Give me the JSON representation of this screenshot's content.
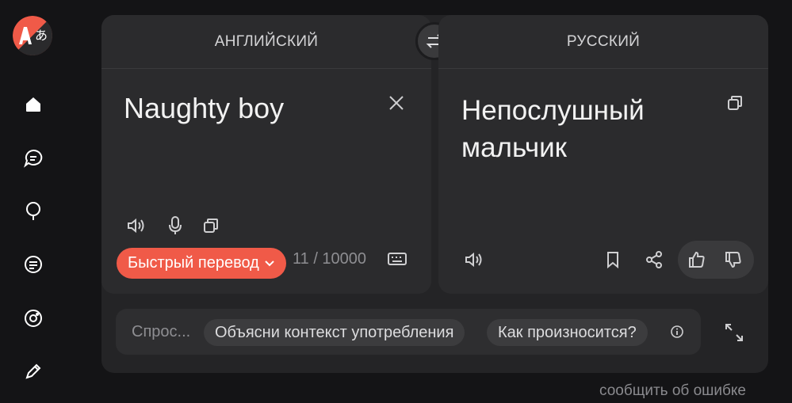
{
  "source": {
    "language": "АНГЛИЙСКИЙ",
    "text": "Naughty boy",
    "counter": "11 / 10000",
    "mode_label": "Быстрый перевод"
  },
  "target": {
    "language": "РУССКИЙ",
    "text": "Непослушный мальчик"
  },
  "assistant": {
    "placeholder": "Спрос...",
    "chips": [
      "Объясни контекст употребления",
      "Как произносится?"
    ]
  },
  "footer": {
    "report_label": "сообщить об ошибке"
  },
  "colors": {
    "accent": "#f05a48",
    "panel": "#2b2b2d",
    "background": "#141416"
  },
  "icons": {
    "sidebar": [
      "home-icon",
      "chat-icon",
      "bulb-icon",
      "document-icon",
      "camera-icon",
      "pen-icon"
    ]
  }
}
